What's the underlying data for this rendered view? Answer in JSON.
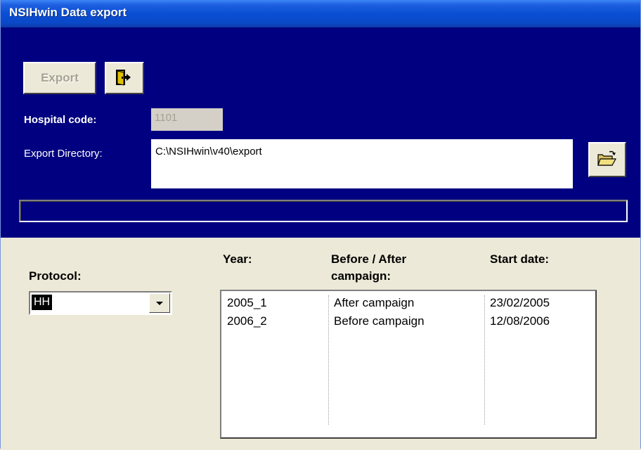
{
  "window": {
    "title": "NSIHwin Data export"
  },
  "toolbar": {
    "export_label": "Export",
    "exit_icon": "door-exit-icon",
    "browse_icon": "folder-open-icon"
  },
  "form": {
    "hospital_code_label": "Hospital code:",
    "hospital_code_value": "1101",
    "export_dir_label": "Export Directory:",
    "export_dir_value": "C:\\NSIHwin\\v40\\export"
  },
  "protocol": {
    "label": "Protocol:",
    "selected": "HH"
  },
  "campaigns": {
    "headers": {
      "year": "Year:",
      "before_after_line1": "Before / After",
      "before_after_line2": "campaign:",
      "start_date": "Start date:"
    },
    "rows": [
      {
        "year": "2005_1",
        "status": "After campaign",
        "start_date": "23/02/2005"
      },
      {
        "year": "2006_2",
        "status": "Before campaign",
        "start_date": "12/08/2006"
      }
    ]
  },
  "colors": {
    "navy_panel": "#000080",
    "titlebar": "#0a4fd4",
    "dialog_bg": "#ece9d8"
  }
}
